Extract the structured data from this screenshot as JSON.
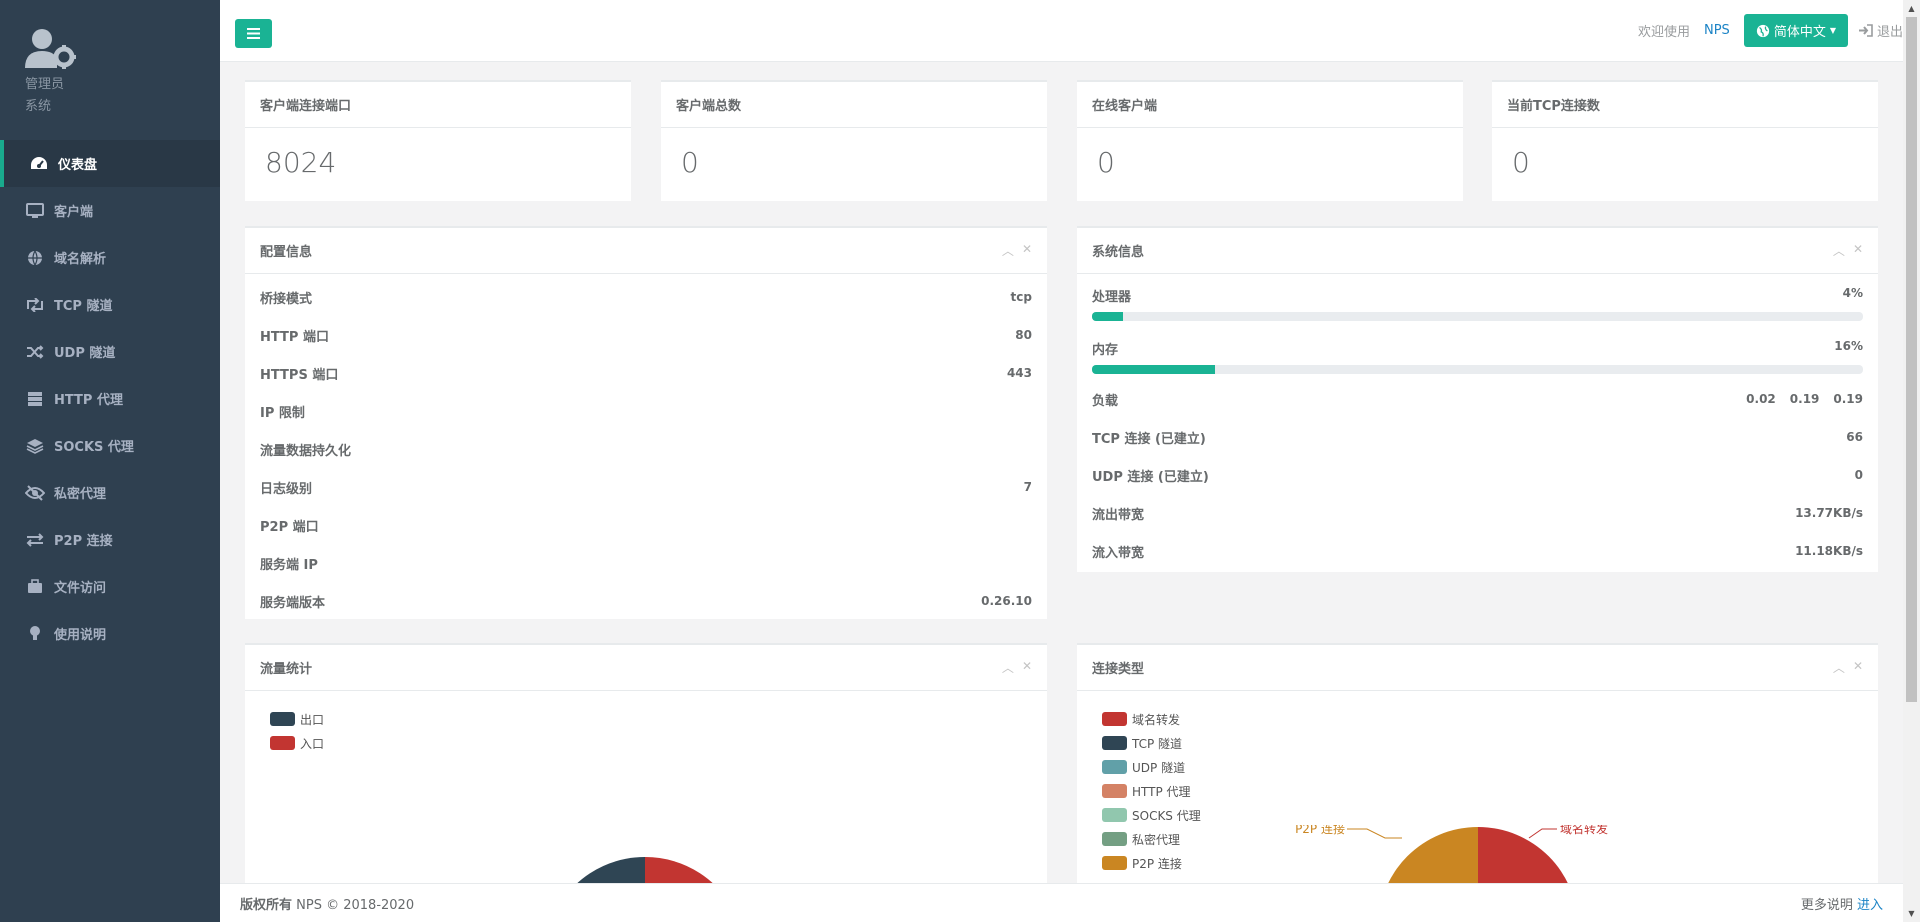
{
  "sidebar": {
    "profile_name": "管理员",
    "profile_role": "系统",
    "items": [
      {
        "label": "仪表盘",
        "icon": "dashboard-icon"
      },
      {
        "label": "客户端",
        "icon": "desktop-icon"
      },
      {
        "label": "域名解析",
        "icon": "globe-icon"
      },
      {
        "label": "TCP 隧道",
        "icon": "retweet-icon"
      },
      {
        "label": "UDP 隧道",
        "icon": "random-icon"
      },
      {
        "label": "HTTP 代理",
        "icon": "server-icon"
      },
      {
        "label": "SOCKS 代理",
        "icon": "layers-icon"
      },
      {
        "label": "私密代理",
        "icon": "eye-slash-icon"
      },
      {
        "label": "P2P 连接",
        "icon": "exchange-icon"
      },
      {
        "label": "文件访问",
        "icon": "briefcase-icon"
      },
      {
        "label": "使用说明",
        "icon": "lightbulb-icon"
      }
    ]
  },
  "topbar": {
    "welcome": "欢迎使用",
    "app_link": "NPS",
    "language": "简体中文",
    "logout": "退出"
  },
  "stats": [
    {
      "title": "客户端连接端口",
      "value": "8024"
    },
    {
      "title": "客户端总数",
      "value": "0"
    },
    {
      "title": "在线客户端",
      "value": "0"
    },
    {
      "title": "当前TCP连接数",
      "value": "0"
    }
  ],
  "config": {
    "title": "配置信息",
    "rows": [
      {
        "label": "桥接模式",
        "value": "tcp"
      },
      {
        "label": "HTTP 端口",
        "value": "80"
      },
      {
        "label": "HTTPS 端口",
        "value": "443"
      },
      {
        "label": "IP 限制",
        "value": ""
      },
      {
        "label": "流量数据持久化",
        "value": ""
      },
      {
        "label": "日志级别",
        "value": "7"
      },
      {
        "label": "P2P 端口",
        "value": ""
      },
      {
        "label": "服务端 IP",
        "value": ""
      },
      {
        "label": "服务端版本",
        "value": "0.26.10"
      }
    ]
  },
  "system": {
    "title": "系统信息",
    "cpu_label": "处理器",
    "cpu_value": "4%",
    "cpu_fraction": 0.04,
    "mem_label": "内存",
    "mem_value": "16%",
    "mem_fraction": 0.16,
    "load_label": "负载",
    "load_values": [
      "0.02",
      "0.19",
      "0.19"
    ],
    "rows": [
      {
        "label": "TCP 连接 (已建立)",
        "value": "66"
      },
      {
        "label": "UDP 连接 (已建立)",
        "value": "0"
      },
      {
        "label": "流出带宽",
        "value": "13.77KB/s"
      },
      {
        "label": "流入带宽",
        "value": "11.18KB/s"
      }
    ]
  },
  "traffic": {
    "title": "流量统计",
    "legend": [
      {
        "label": "出口",
        "color": "#2f4554"
      },
      {
        "label": "入口",
        "color": "#c23531"
      }
    ]
  },
  "conn_types": {
    "title": "连接类型",
    "legend": [
      {
        "label": "域名转发",
        "color": "#c23531"
      },
      {
        "label": "TCP 隧道",
        "color": "#2f4554"
      },
      {
        "label": "UDP 隧道",
        "color": "#61a0a8"
      },
      {
        "label": "HTTP 代理",
        "color": "#d48265"
      },
      {
        "label": "SOCKS 代理",
        "color": "#91c7ae"
      },
      {
        "label": "私密代理",
        "color": "#749f83"
      },
      {
        "label": "P2P 连接",
        "color": "#ca8622"
      }
    ],
    "pie_label_left": "P2P 连接",
    "pie_label_right": "域名转发"
  },
  "footer": {
    "copyright_bold": "版权所有",
    "copyright": "NPS © 2018-2020",
    "more": "更多说明",
    "enter": "进入"
  }
}
